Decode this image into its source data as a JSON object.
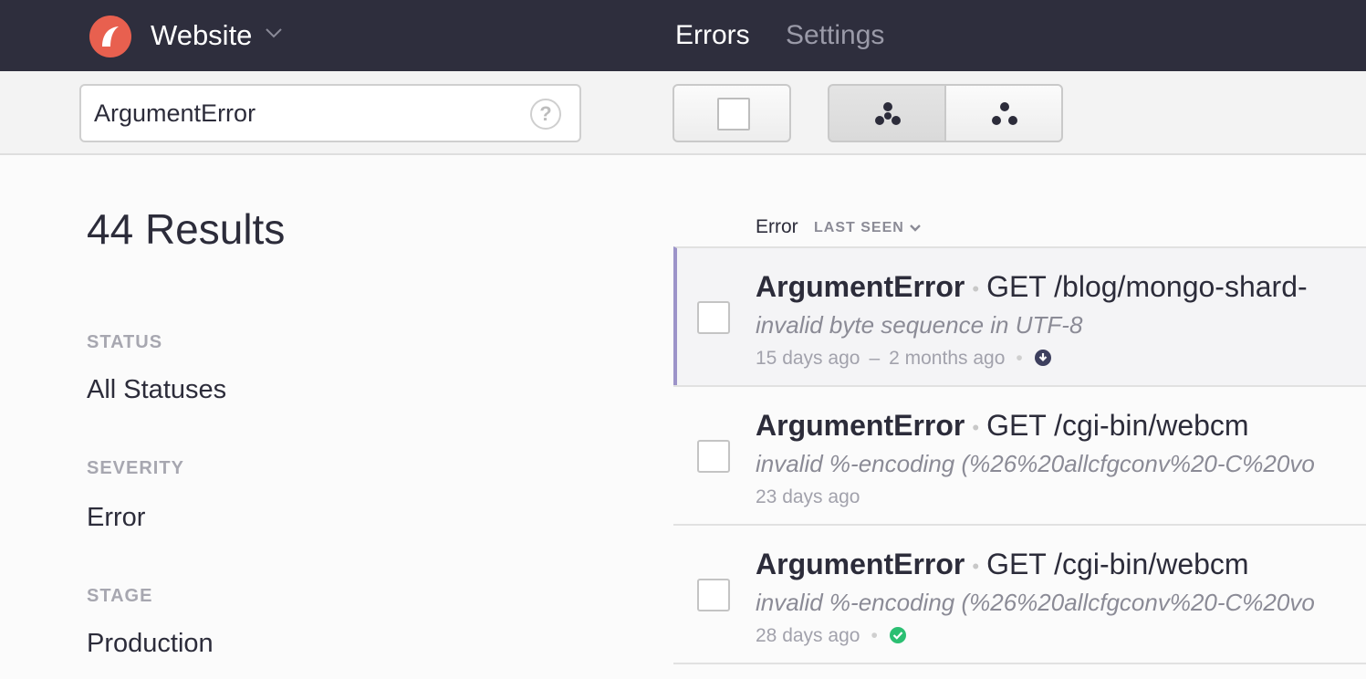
{
  "header": {
    "app_name": "Website",
    "nav": {
      "errors": "Errors",
      "settings": "Settings"
    },
    "colors": {
      "background": "#2e2e3d",
      "logo": "#e8604f"
    }
  },
  "toolbar": {
    "search_value": "ArgumentError",
    "help_glyph": "?"
  },
  "sidebar": {
    "results": "44 Results",
    "facets": [
      {
        "label": "STATUS",
        "value": "All Statuses"
      },
      {
        "label": "SEVERITY",
        "value": "Error"
      },
      {
        "label": "STAGE",
        "value": "Production"
      }
    ]
  },
  "list": {
    "header": {
      "column": "Error",
      "sort": "LAST SEEN"
    },
    "rows": [
      {
        "error_class": "ArgumentError",
        "context": "GET /blog/mongo-shard-",
        "message": "invalid byte sequence in UTF-8",
        "last_seen": "15 days ago",
        "first_seen": "2 months ago",
        "status_icon": "download-circle-icon",
        "active": true
      },
      {
        "error_class": "ArgumentError",
        "context": "GET /cgi-bin/webcm",
        "message": "invalid %-encoding (%26%20allcfgconv%20-C%20vo",
        "last_seen": "23 days ago",
        "active": false
      },
      {
        "error_class": "ArgumentError",
        "context": "GET /cgi-bin/webcm",
        "message": "invalid %-encoding (%26%20allcfgconv%20-C%20vo",
        "last_seen": "28 days ago",
        "status_icon": "check-circle-icon",
        "active": false
      }
    ],
    "colors": {
      "active_border": "#9c93c9",
      "resolved": "#2bbf72",
      "indicator": "#3d3f5e"
    }
  }
}
